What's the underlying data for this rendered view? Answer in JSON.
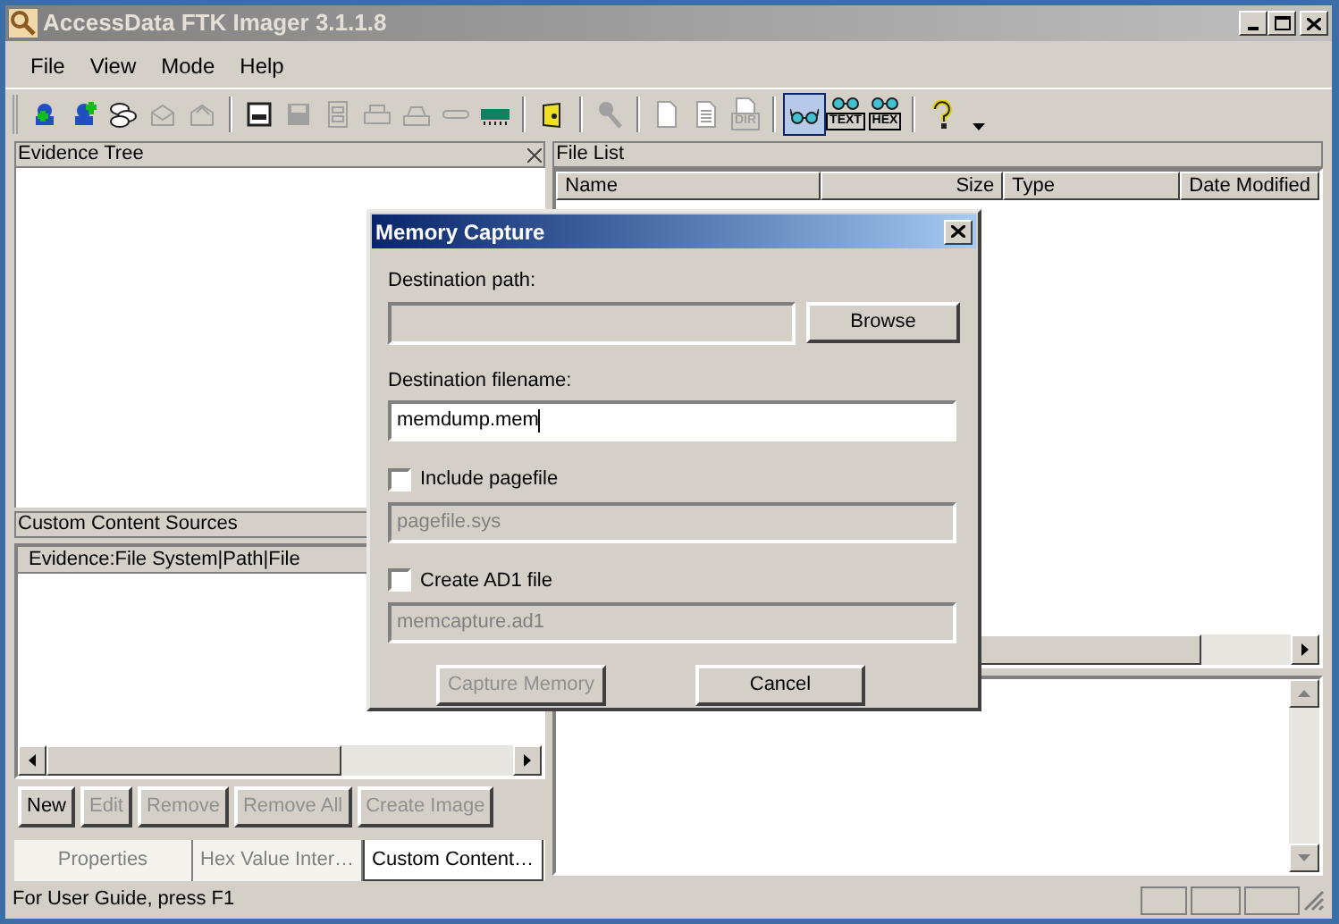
{
  "window": {
    "title": "AccessData FTK Imager 3.1.1.8"
  },
  "menu": [
    "File",
    "View",
    "Mode",
    "Help"
  ],
  "toolbar": [
    [
      {
        "disabled": false
      },
      {
        "disabled": false
      },
      {
        "disabled": false
      },
      {
        "disabled": true
      },
      {
        "disabled": true
      }
    ],
    [
      {
        "disabled": false
      },
      {
        "disabled": true
      },
      {
        "disabled": true
      },
      {
        "disabled": true
      },
      {
        "disabled": true
      },
      {
        "disabled": true
      },
      {
        "disabled": false
      }
    ],
    [
      {
        "disabled": false
      }
    ],
    [
      {
        "disabled": true
      }
    ],
    [
      {
        "disabled": true
      },
      {
        "disabled": true
      },
      {
        "disabled": true,
        "label": "DIR"
      }
    ],
    [
      {
        "selected": true
      },
      {
        "selected": false,
        "label": "TEXT"
      },
      {
        "selected": false,
        "label": "HEX"
      }
    ],
    [
      {
        "disabled": false
      }
    ]
  ],
  "evidence_tree": {
    "title": "Evidence Tree"
  },
  "custom_content": {
    "title": "Custom Content Sources",
    "column": "Evidence:File System|Path|File",
    "buttons": [
      {
        "label": "New",
        "disabled": false
      },
      {
        "label": "Edit",
        "disabled": true
      },
      {
        "label": "Remove",
        "disabled": true
      },
      {
        "label": "Remove All",
        "disabled": true
      },
      {
        "label": "Create Image",
        "disabled": true
      }
    ]
  },
  "tabs": [
    {
      "label": "Properties",
      "selected": false
    },
    {
      "label": "Hex Value Inter…",
      "selected": false
    },
    {
      "label": "Custom Content…",
      "selected": true
    }
  ],
  "file_list": {
    "title": "File List",
    "columns": [
      "Name",
      "Size",
      "Type",
      "Date Modified"
    ]
  },
  "status_bar": {
    "text": "For User Guide, press F1"
  },
  "dialog": {
    "title": "Memory Capture",
    "path_label": "Destination path:",
    "browse": "Browse",
    "filename_label": "Destination filename:",
    "filename_value": "memdump.mem",
    "options": [
      {
        "label": "Include pagefile",
        "checked": false,
        "value": "pagefile.sys"
      },
      {
        "label": "Create AD1 file",
        "checked": false,
        "value": "memcapture.ad1"
      }
    ],
    "buttons": [
      {
        "label": "Capture Memory",
        "disabled": true
      },
      {
        "label": "Cancel",
        "disabled": false
      }
    ]
  }
}
